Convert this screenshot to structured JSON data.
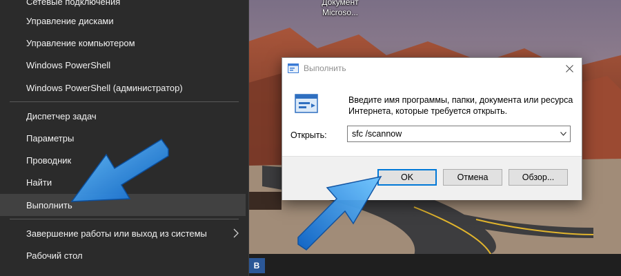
{
  "desktop": {
    "icon_label_line1": "Документ",
    "icon_label_line2": "Microso..."
  },
  "winx_menu": {
    "items": [
      {
        "label": "Сетевые подключения",
        "highlighted": false
      },
      {
        "label": "Управление дисками",
        "highlighted": false
      },
      {
        "label": "Управление компьютером",
        "highlighted": false
      },
      {
        "label": "Windows PowerShell",
        "highlighted": false
      },
      {
        "label": "Windows PowerShell (администратор)",
        "highlighted": false
      },
      {
        "label": "Диспетчер задач",
        "highlighted": false
      },
      {
        "label": "Параметры",
        "highlighted": false
      },
      {
        "label": "Проводник",
        "highlighted": false
      },
      {
        "label": "Найти",
        "highlighted": false
      },
      {
        "label": "Выполнить",
        "highlighted": true
      },
      {
        "label": "Завершение работы или выход из системы",
        "highlighted": false,
        "has_submenu": true
      },
      {
        "label": "Рабочий стол",
        "highlighted": false
      }
    ]
  },
  "run_dialog": {
    "title": "Выполнить",
    "description": "Введите имя программы, папки, документа или ресурса Интернета, которые требуется открыть.",
    "open_label": "Открыть:",
    "open_value": "sfc /scannow",
    "ok_label": "OK",
    "cancel_label": "Отмена",
    "browse_label": "Обзор..."
  },
  "taskbar": {
    "app_letter": "B"
  },
  "colors": {
    "menu_bg": "#2b2b2b",
    "menu_highlight": "#414141",
    "accent_blue": "#0078d7",
    "arrow_blue": "#1e90ff",
    "taskbar_bg": "#1f1f1f"
  },
  "icons": [
    "run-app-icon",
    "close-icon",
    "chevron-right-icon",
    "dropdown-arrow-icon",
    "annotation-arrow"
  ]
}
